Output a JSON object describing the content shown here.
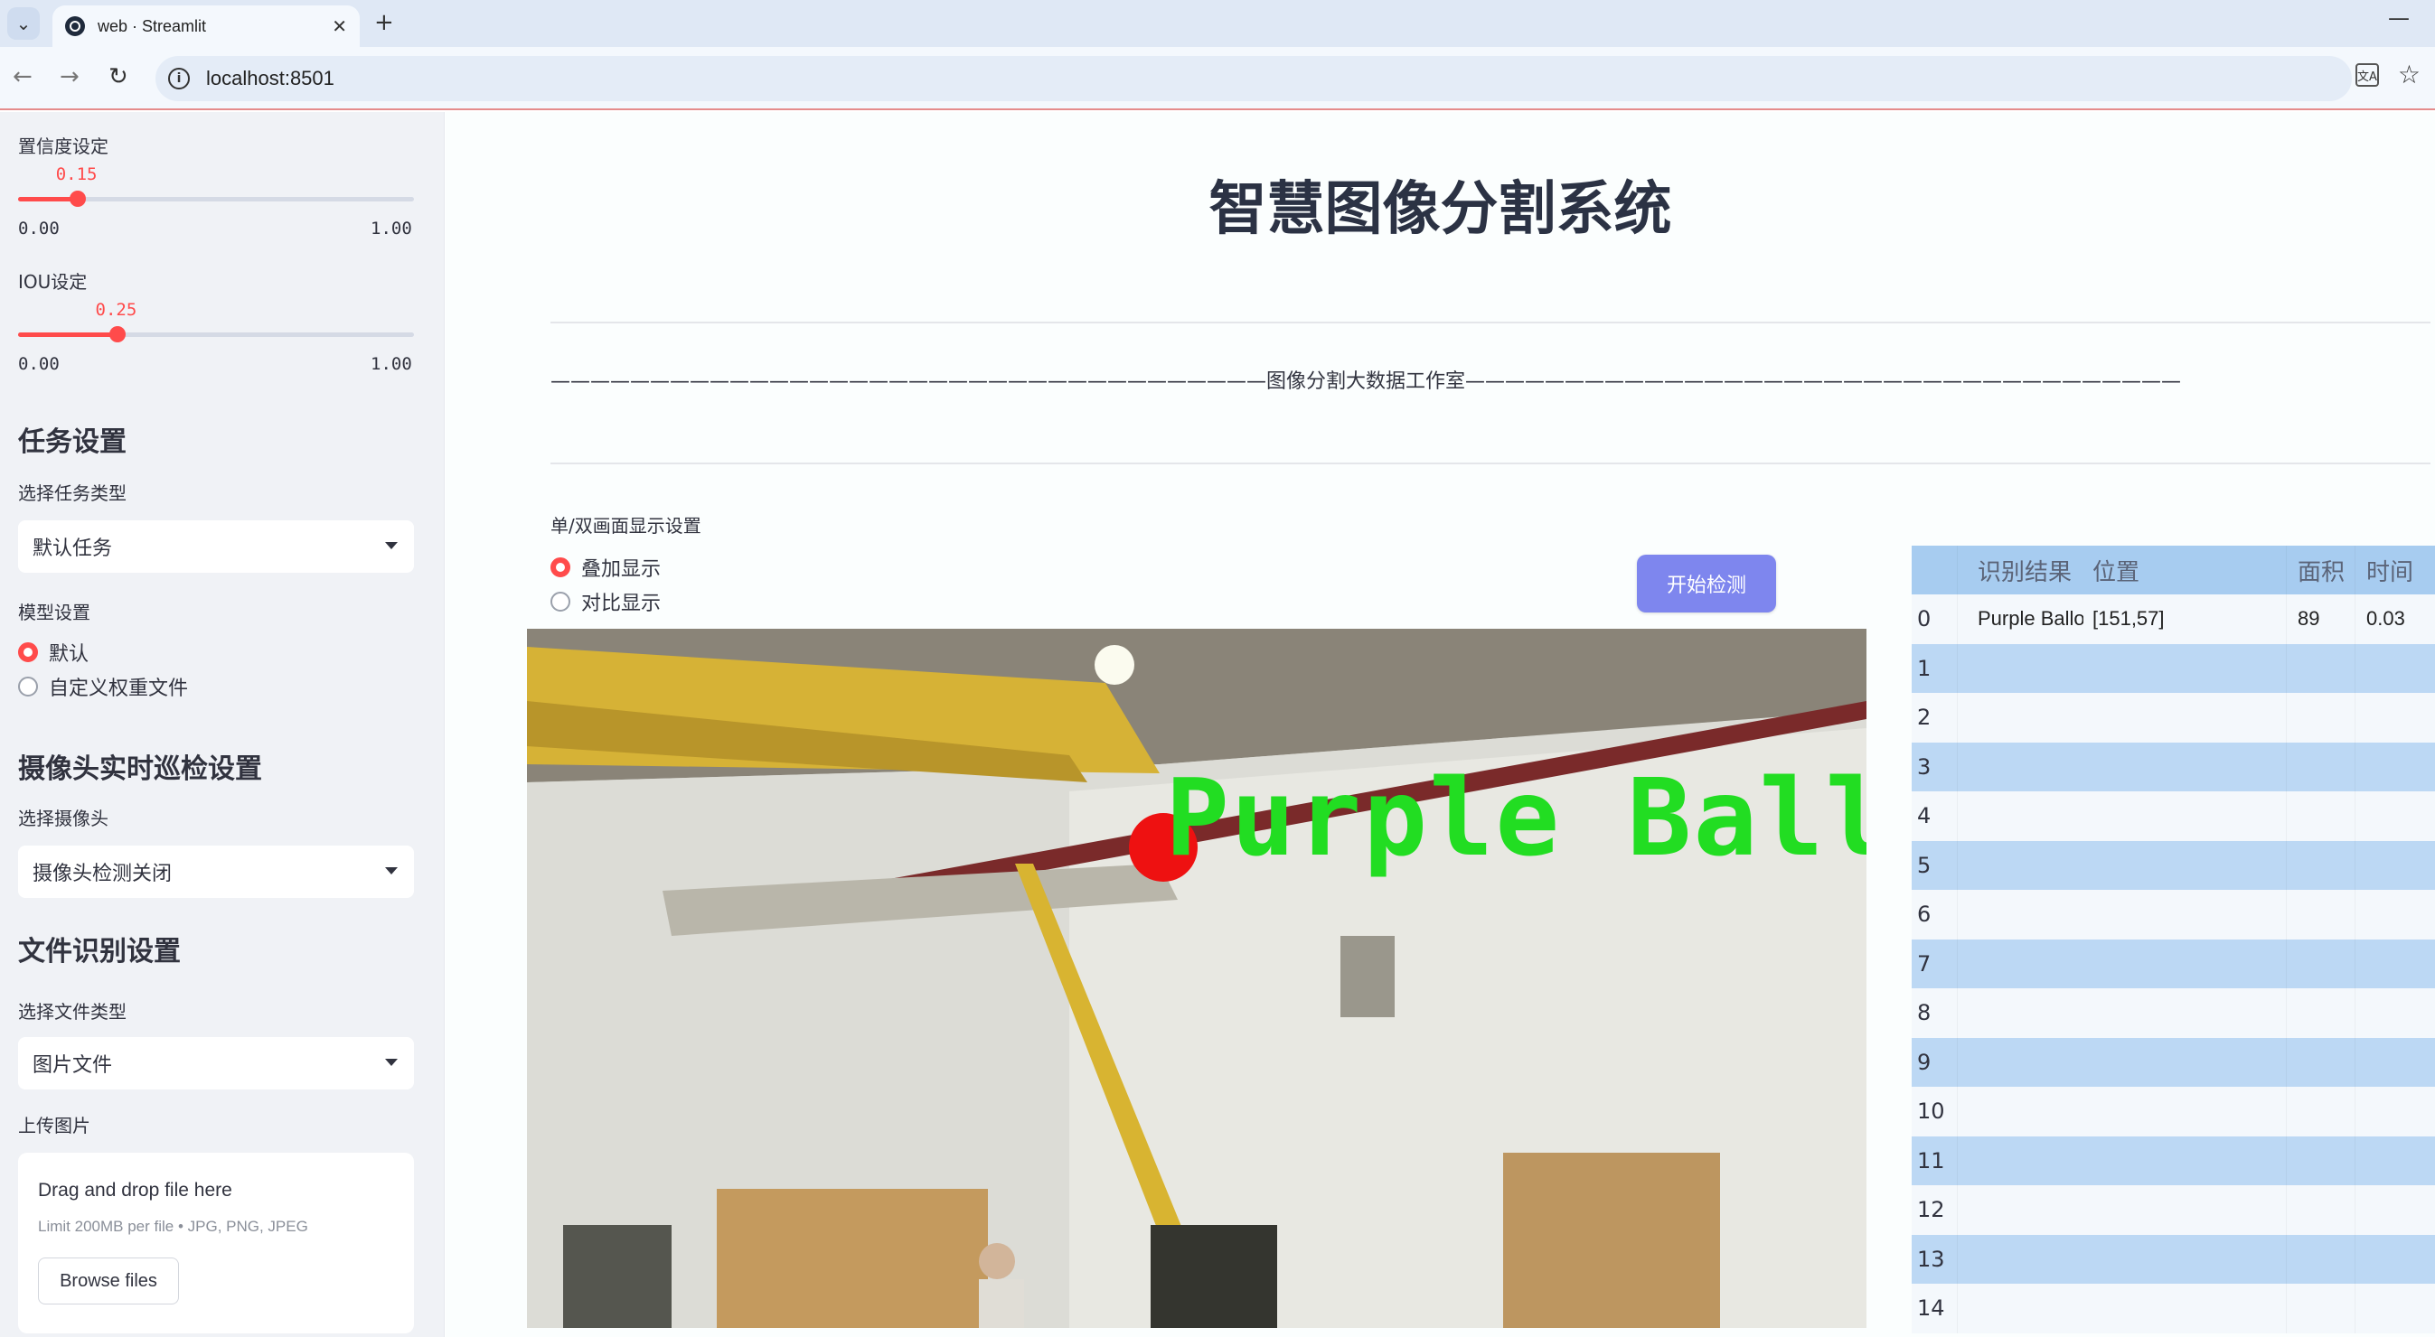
{
  "browser": {
    "tab_title": "web · Streamlit",
    "url": "localhost:8501"
  },
  "sidebar": {
    "confidence": {
      "label": "置信度设定",
      "value": "0.15",
      "fraction": 0.15,
      "min": "0.00",
      "max": "1.00"
    },
    "iou": {
      "label": "IOU设定",
      "value": "0.25",
      "fraction": 0.25,
      "min": "0.00",
      "max": "1.00"
    },
    "task_section": {
      "heading": "任务设置",
      "select_label": "选择任务类型",
      "selected": "默认任务"
    },
    "model_section": {
      "label": "模型设置",
      "options": [
        "默认",
        "自定义权重文件"
      ],
      "selected_index": 0
    },
    "camera_section": {
      "heading": "摄像头实时巡检设置",
      "select_label": "选择摄像头",
      "selected": "摄像头检测关闭"
    },
    "file_section": {
      "heading": "文件识别设置",
      "select_label": "选择文件类型",
      "selected": "图片文件"
    },
    "upload": {
      "label": "上传图片",
      "title": "Drag and drop file here",
      "hint": "Limit 200MB per file • JPG, PNG, JPEG",
      "button": "Browse files"
    }
  },
  "main": {
    "title": "智慧图像分割系统",
    "banner": "————————————————————————————————————图像分割大数据工作室————————————————————————————————————",
    "display_mode": {
      "label": "单/双画面显示设置",
      "options": [
        "叠加显示",
        "对比显示"
      ],
      "selected_index": 0
    },
    "start_button": "开始检测",
    "image": {
      "overlay_label": "Purple Ballo",
      "label_color": "#22dd22",
      "mask_color": "#ee1111"
    },
    "table": {
      "columns": [
        "",
        "识别结果",
        "位置",
        "面积",
        "时间"
      ],
      "rows": [
        {
          "index": "0",
          "result": "Purple Balloon",
          "position": "[151,57]",
          "area": "89",
          "time": "0.03"
        },
        {
          "index": "1",
          "result": "",
          "position": "",
          "area": "",
          "time": ""
        },
        {
          "index": "2",
          "result": "",
          "position": "",
          "area": "",
          "time": ""
        },
        {
          "index": "3",
          "result": "",
          "position": "",
          "area": "",
          "time": ""
        },
        {
          "index": "4",
          "result": "",
          "position": "",
          "area": "",
          "time": ""
        },
        {
          "index": "5",
          "result": "",
          "position": "",
          "area": "",
          "time": ""
        },
        {
          "index": "6",
          "result": "",
          "position": "",
          "area": "",
          "time": ""
        },
        {
          "index": "7",
          "result": "",
          "position": "",
          "area": "",
          "time": ""
        },
        {
          "index": "8",
          "result": "",
          "position": "",
          "area": "",
          "time": ""
        },
        {
          "index": "9",
          "result": "",
          "position": "",
          "area": "",
          "time": ""
        },
        {
          "index": "10",
          "result": "",
          "position": "",
          "area": "",
          "time": ""
        },
        {
          "index": "11",
          "result": "",
          "position": "",
          "area": "",
          "time": ""
        },
        {
          "index": "12",
          "result": "",
          "position": "",
          "area": "",
          "time": ""
        },
        {
          "index": "13",
          "result": "",
          "position": "",
          "area": "",
          "time": ""
        },
        {
          "index": "14",
          "result": "",
          "position": "",
          "area": "",
          "time": ""
        }
      ]
    }
  },
  "colors": {
    "accent": "#ff4b4b",
    "button": "#7e86ee",
    "table_header": "#a7ccf0",
    "table_band": "#bcd8f4"
  }
}
